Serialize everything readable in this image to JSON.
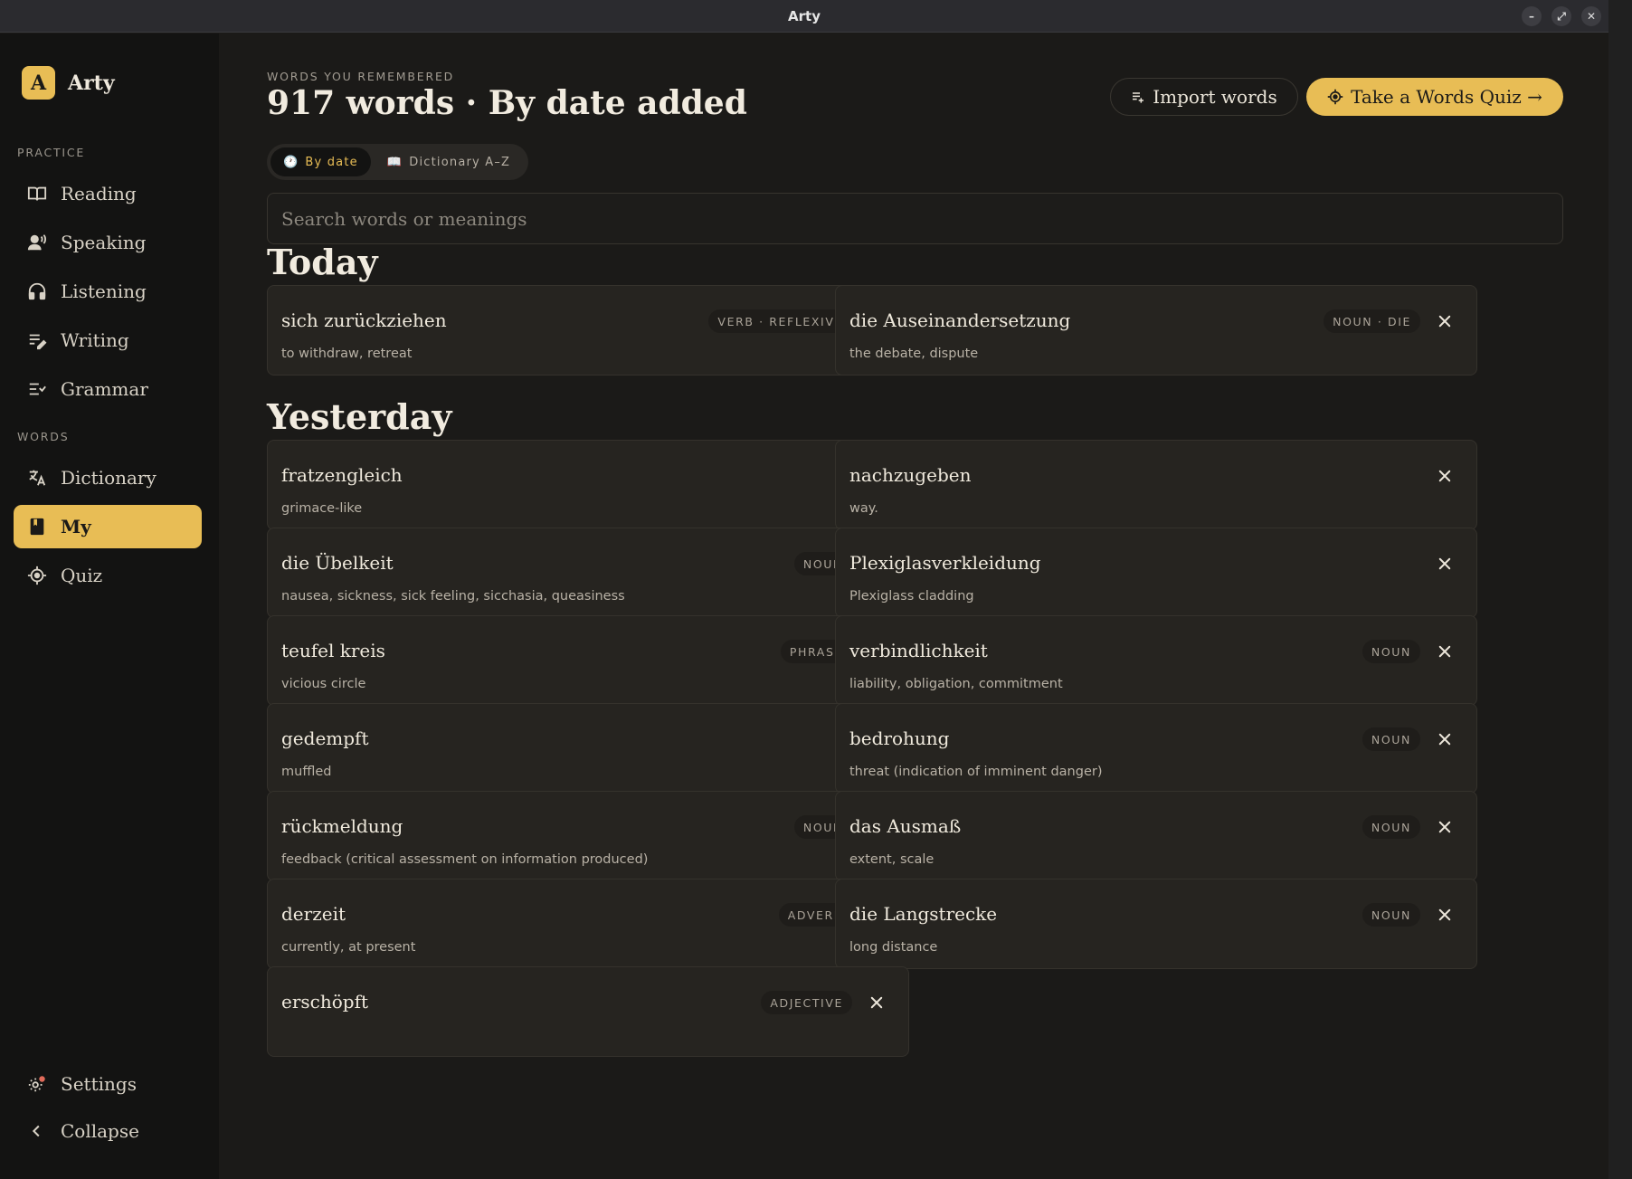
{
  "window": {
    "title": "Arty",
    "controls": [
      "minimize",
      "restore",
      "close"
    ]
  },
  "sidebar": {
    "brand": {
      "logo_letter": "A",
      "name": "Arty"
    },
    "sections": [
      {
        "label": "PRACTICE",
        "items": [
          {
            "label": "Reading",
            "icon": "book-open-icon"
          },
          {
            "label": "Speaking",
            "icon": "speaking-person-icon"
          },
          {
            "label": "Listening",
            "icon": "headphones-icon"
          },
          {
            "label": "Writing",
            "icon": "pen-lines-icon"
          },
          {
            "label": "Grammar",
            "icon": "checklist-icon"
          }
        ]
      },
      {
        "label": "WORDS",
        "items": [
          {
            "label": "Dictionary",
            "icon": "translate-icon"
          },
          {
            "label": "My",
            "icon": "bookmark-book-icon",
            "active": true
          },
          {
            "label": "Quiz",
            "icon": "target-icon"
          }
        ]
      }
    ],
    "footer": [
      {
        "label": "Settings",
        "icon": "gear-icon"
      },
      {
        "label": "Collapse",
        "icon": "chevron-left-icon"
      }
    ]
  },
  "header": {
    "eyebrow": "WORDS YOU REMEMBERED",
    "title": "917 words · By date added",
    "import_label": "Import words",
    "quiz_label": "Take a Words Quiz →"
  },
  "sort_toggle": {
    "options": [
      {
        "label": "By date",
        "icon": "clock-icon",
        "icon_glyph": "🕐",
        "active": true
      },
      {
        "label": "Dictionary A–Z",
        "icon": "book-icon",
        "icon_glyph": "📖",
        "active": false
      }
    ]
  },
  "search": {
    "placeholder": "Search words or meanings",
    "value": ""
  },
  "groups": [
    {
      "title": "Today",
      "words": [
        {
          "word": "sich zurückziehen",
          "meaning": "to withdraw, retreat",
          "tag": "VERB · REFLEXIVE"
        },
        {
          "word": "die Auseinandersetzung",
          "meaning": "the debate, dispute",
          "tag": "NOUN · DIE"
        }
      ]
    },
    {
      "title": "Yesterday",
      "words": [
        {
          "word": "fratzengleich",
          "meaning": "grimace-like",
          "tag": ""
        },
        {
          "word": "nachzugeben",
          "meaning": "way.",
          "tag": ""
        },
        {
          "word": "die Übelkeit",
          "meaning": "nausea, sickness, sick feeling, sicchasia, queasiness",
          "tag": "NOUN"
        },
        {
          "word": "Plexiglasverkleidung",
          "meaning": "Plexiglass cladding",
          "tag": ""
        },
        {
          "word": "teufel kreis",
          "meaning": "vicious circle",
          "tag": "PHRASE"
        },
        {
          "word": "verbindlichkeit",
          "meaning": "liability, obligation, commitment",
          "tag": "NOUN"
        },
        {
          "word": "gedempft",
          "meaning": "muffled",
          "tag": ""
        },
        {
          "word": "bedrohung",
          "meaning": "threat (indication of imminent danger)",
          "tag": "NOUN"
        },
        {
          "word": "rückmeldung",
          "meaning": "feedback (critical assessment on information produced)",
          "tag": "NOUN"
        },
        {
          "word": "das Ausmaß",
          "meaning": "extent, scale",
          "tag": "NOUN"
        },
        {
          "word": "derzeit",
          "meaning": "currently, at present",
          "tag": "ADVERB"
        },
        {
          "word": "die Langstrecke",
          "meaning": "long distance",
          "tag": "NOUN"
        },
        {
          "word": "erschöpft",
          "meaning": "",
          "tag": "ADJECTIVE"
        }
      ]
    }
  ],
  "colors": {
    "accent": "#e8bd55",
    "background": "#1b1a18",
    "sidebar": "#131312",
    "card": "#262420"
  }
}
